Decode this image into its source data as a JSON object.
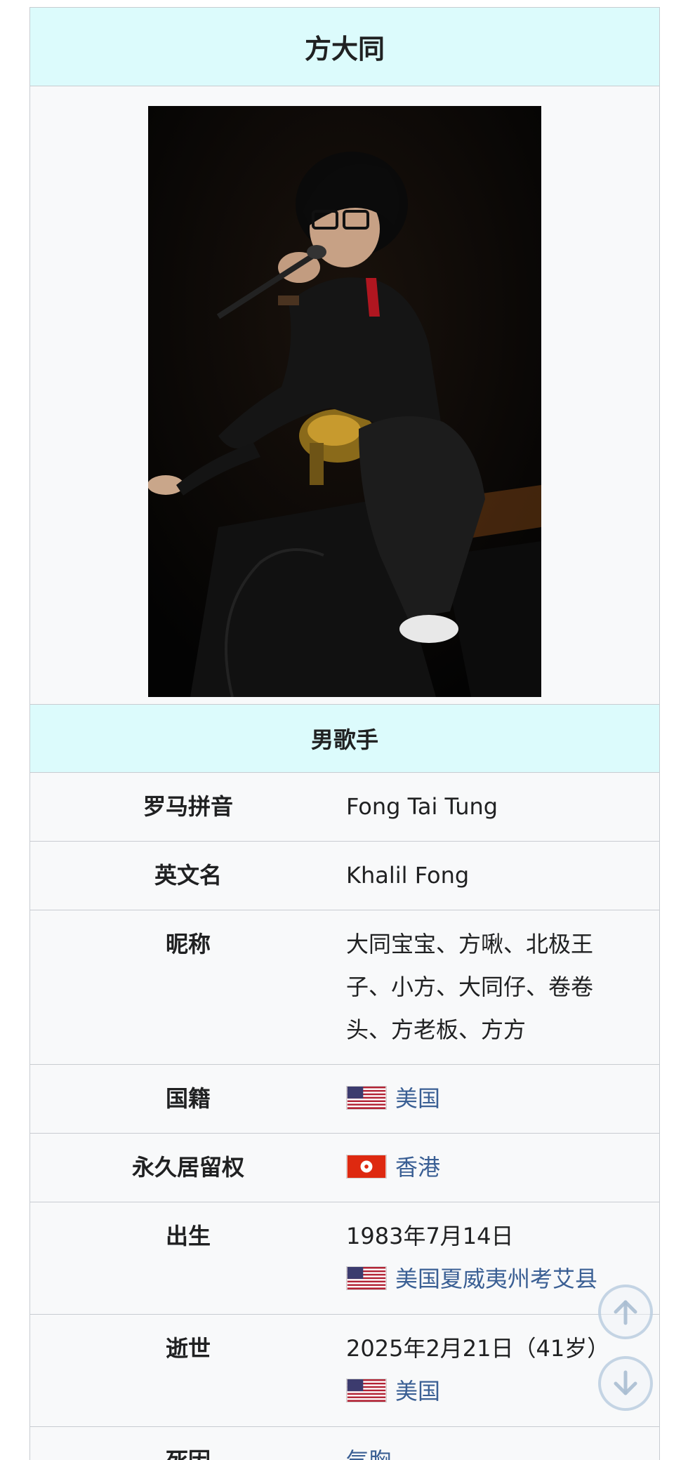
{
  "infobox": {
    "title": "方大同",
    "subtitle": "男歌手",
    "rows": [
      {
        "label": "罗马拼音",
        "value": "Fong Tai Tung"
      },
      {
        "label": "英文名",
        "value": "Khalil Fong"
      },
      {
        "label": "昵称",
        "lines": [
          "大同宝宝、方啾、北极王",
          "子、小方、大同仔、卷卷",
          "头、方老板、方方"
        ]
      },
      {
        "label": "国籍",
        "flag": "us-flag",
        "link": "美国"
      },
      {
        "label": "永久居留权",
        "flag": "hk-flag",
        "link": "香港"
      },
      {
        "label": "出生",
        "date": "1983年7月14日",
        "flag": "us-flag",
        "link": "美国夏威夷州考艾县"
      },
      {
        "label": "逝世",
        "date": "2025年2月21日（41岁）",
        "flag": "us-flag",
        "link": "美国"
      },
      {
        "label": "死因",
        "link": "气胸"
      }
    ]
  },
  "scroll_buttons": {
    "up_icon": "arrow-up-icon",
    "down_icon": "arrow-down-icon"
  },
  "colors": {
    "header_bg": "#dcfbfc",
    "link": "#3a5f94",
    "border": "#c8ccd1"
  }
}
